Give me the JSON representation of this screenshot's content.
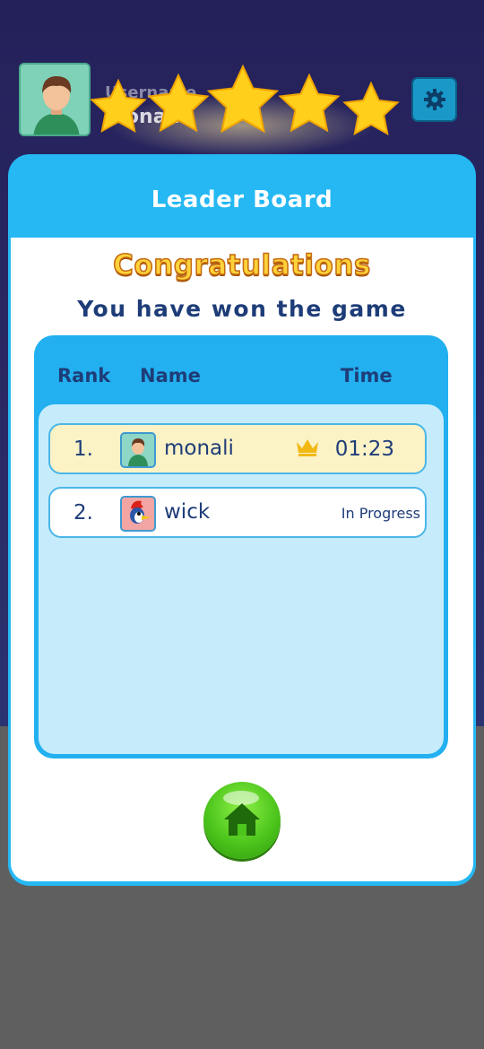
{
  "header": {
    "username_label": "Username",
    "username_value": "monali",
    "avatar_icon": "boy-avatar-icon",
    "settings_icon": "gear-icon"
  },
  "stars": {
    "earned": 5,
    "total": 5
  },
  "dialog": {
    "title": "Leader Board",
    "congrats": "Congratulations",
    "message": "You have won the game"
  },
  "leaderboard": {
    "columns": {
      "rank": "Rank",
      "name": "Name",
      "time": "Time"
    },
    "rows": [
      {
        "rank": "1.",
        "name": "monali",
        "time": "01:23",
        "avatar": "boy-avatar-icon",
        "crown": true
      },
      {
        "rank": "2.",
        "name": "wick",
        "status": "In Progress",
        "avatar": "woodpecker-avatar-icon",
        "crown": false
      }
    ]
  },
  "colors": {
    "accent": "#25b8f3",
    "text": "#1e3d78",
    "congrats": "#ffd23a",
    "home_button": "#4cc51c"
  }
}
